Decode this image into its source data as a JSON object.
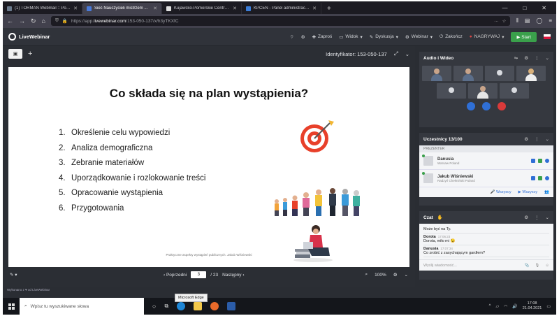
{
  "browser": {
    "tabs": [
      {
        "label": "(1) TORMAN Webmail :: Polic...",
        "active": false
      },
      {
        "label": "Sieć Nauczycieli mistrzem ...",
        "active": true
      },
      {
        "label": "Kujawsko-Pomorskie Centrum ...",
        "active": false
      },
      {
        "label": "KPCEN - Panel administracyjny",
        "active": false
      }
    ],
    "new_tab": "+",
    "window_controls": [
      "—",
      "□",
      "✕"
    ],
    "url_prefix": "https://app.",
    "url_domain": "livewebinar.com",
    "url_rest": "/153-050-137/x/h3yTKXfC",
    "url_more": "···"
  },
  "app": {
    "brand": "LiveWebinar",
    "menu": {
      "invite": "Zaproś",
      "view": "Widok",
      "discussion": "Dyskusja",
      "webinar": "Webinar",
      "close": "Zakończ",
      "record": "NAGRYWAJ",
      "start": "Start"
    }
  },
  "stage": {
    "identifier": "Identyfikator: 153-050-137",
    "slide": {
      "title": "Co składa się na plan wystąpienia?",
      "items": [
        {
          "num": "1.",
          "text": "Określenie celu wypowiedzi"
        },
        {
          "num": "2.",
          "text": "Analiza demograficzna"
        },
        {
          "num": "3.",
          "text": "Zebranie materiałów"
        },
        {
          "num": "4.",
          "text": "Uporządkowanie i rozlokowanie treści"
        },
        {
          "num": "5.",
          "text": "Opracowanie wystąpienia"
        },
        {
          "num": "6.",
          "text": "Przygotowania"
        }
      ],
      "footer": "Praktyczne aspekty wystąpień publicznych. Jakub Wiśniewski"
    },
    "pager": {
      "prev": "‹ Poprzedni",
      "current_page": "3",
      "total": "/ 23",
      "next": "Następny ›"
    },
    "zoom": "100%"
  },
  "panels": {
    "av": {
      "title": "Audio i Wideo"
    },
    "participants": {
      "title": "Uczestnicy 13/100",
      "presenter_label": "PREZENTER",
      "people": [
        {
          "name": "Danusia",
          "location": "Warsaw Poland"
        },
        {
          "name": "Jakub Wiśniewski",
          "location": "Radzyń Chełmiński Poland"
        }
      ],
      "everyone_mic": "Wszyscy",
      "everyone_cam": "Wszyscy"
    },
    "chat": {
      "title": "Czat",
      "messages": [
        {
          "from": "",
          "time": "",
          "text": "Może być na Ty."
        },
        {
          "from": "Dorota",
          "time": "17:06:23",
          "text": "Dorota, miło mi 😉"
        },
        {
          "from": "Danusia",
          "time": "17:07:34",
          "text": "Co zrobić z zasychającym gardłem?"
        }
      ],
      "input_placeholder": "Wyślij wiadomość..."
    }
  },
  "powered_by": "Wykonano z ♥ od LiveWebinar",
  "taskbar": {
    "search_placeholder": "Wpisz tu wyszukiwane słowa",
    "tooltip": "Microsoft Edge",
    "time": "17:08",
    "date": "21.04.2021"
  },
  "colors": {
    "accent": "#2f6fd6",
    "start": "#3aa04b",
    "record": "#e04848"
  }
}
